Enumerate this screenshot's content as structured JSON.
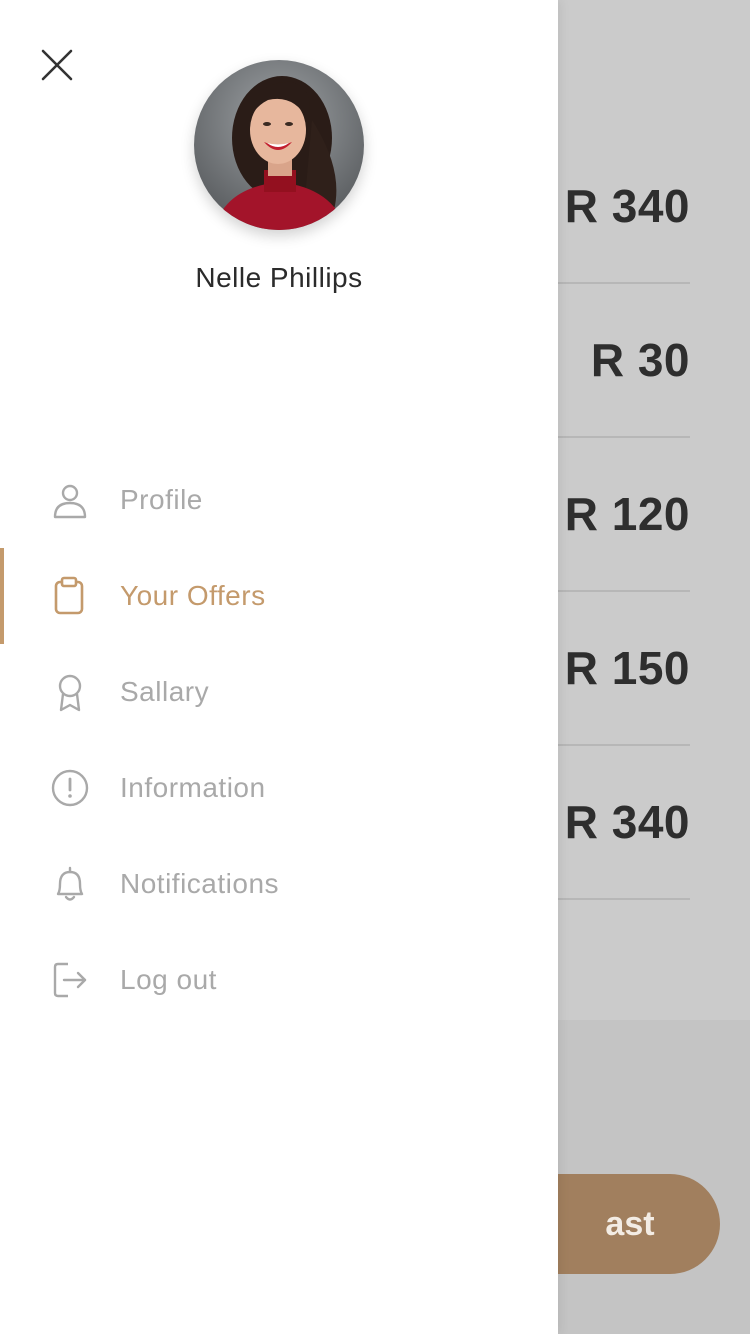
{
  "user": {
    "name": "Nelle Phillips"
  },
  "menu": {
    "items": [
      {
        "label": "Profile",
        "icon": "user-icon",
        "active": false
      },
      {
        "label": "Your Offers",
        "icon": "clipboard-icon",
        "active": true
      },
      {
        "label": "Sallary",
        "icon": "award-icon",
        "active": false
      },
      {
        "label": "Information",
        "icon": "alert-circle-icon",
        "active": false
      },
      {
        "label": "Notifications",
        "icon": "bell-icon",
        "active": false
      },
      {
        "label": "Log out",
        "icon": "logout-icon",
        "active": false
      }
    ]
  },
  "background": {
    "prices": [
      "R 340",
      "R 30",
      "R 120",
      "R 150",
      "R 340"
    ],
    "button_label": "ast"
  },
  "colors": {
    "accent": "#c49a6c",
    "inactive_text": "#a9a9a9",
    "button": "#a17f5e"
  }
}
